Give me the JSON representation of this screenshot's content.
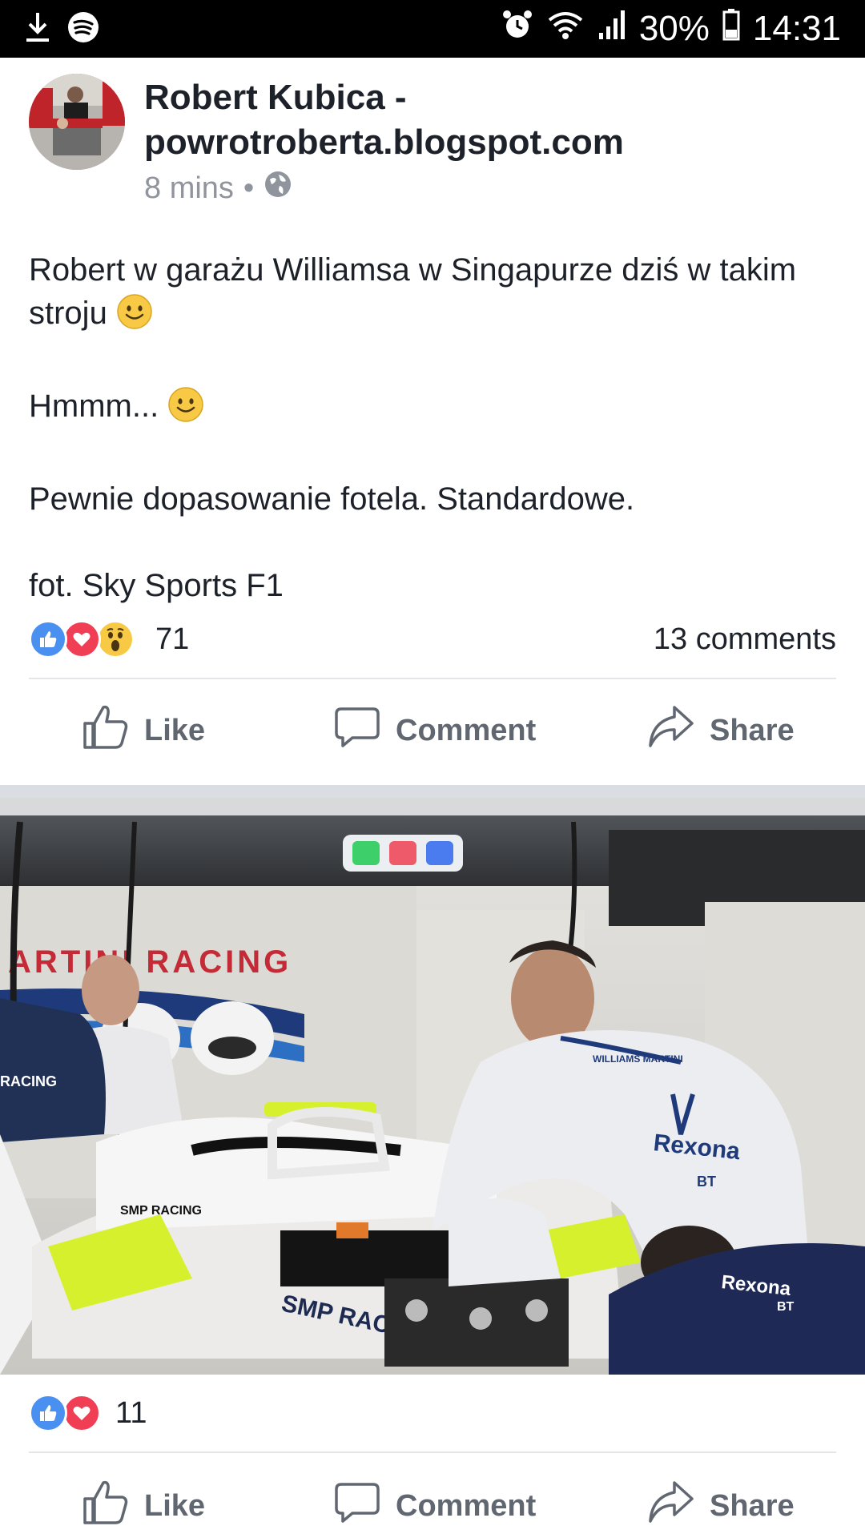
{
  "status_bar": {
    "battery": "30%",
    "time": "14:31",
    "icons": [
      "download-icon",
      "spotify-icon",
      "alarm-icon",
      "wifi-icon",
      "signal-icon",
      "battery-icon"
    ]
  },
  "post": {
    "page_name": "Robert Kubica - powrotroberta.blogspot.com",
    "time_ago": "8 mins",
    "separator": "•",
    "privacy_icon": "globe-icon",
    "paragraphs": [
      "Robert w garażu Williamsa w Singapurze dziś w takim stroju",
      "Hmmm...",
      "Pewnie dopasowanie fotela. Standardowe.",
      "fot. Sky Sports F1"
    ],
    "reactions_count": "71",
    "comments": "13 comments",
    "reaction_types": [
      "like",
      "love",
      "wow"
    ]
  },
  "actions": {
    "like": "Like",
    "comment": "Comment",
    "share": "Share"
  },
  "photo": {
    "wall_text": "ARTINI RACING",
    "sponsor_smp": "SMP RACING",
    "sponsor_rexona": "Rexona",
    "suit_text": "WILLIAMS MARTINI",
    "racing_label": "RACING",
    "bt": "BT"
  },
  "photo_post": {
    "reactions_count": "11",
    "reaction_types": [
      "like",
      "love"
    ]
  },
  "colors": {
    "status_bar": "#000000",
    "text": "#1d2129",
    "muted": "#90949c",
    "action_text": "#606770",
    "like_blue": "#4a90f0",
    "love_red": "#f03e55",
    "wow_yellow": "#f7c945"
  }
}
